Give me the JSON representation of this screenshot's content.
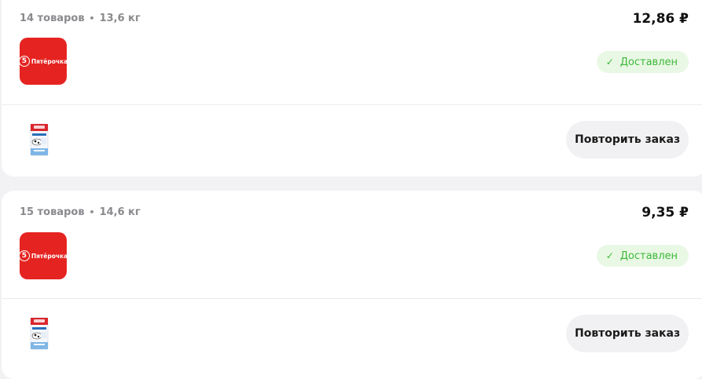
{
  "orders": [
    {
      "items_count": "14 товаров",
      "weight": "13,6 кг",
      "separator": "•",
      "total": "12,86 ₽",
      "store_brand": "Пятёрочка",
      "logo_digit": "5",
      "status_icon": "check-icon",
      "status_check": "✓",
      "status": "Доставлен",
      "repeat_label": "Повторить заказ"
    },
    {
      "items_count": "15 товаров",
      "weight": "14,6 кг",
      "separator": "•",
      "total": "9,35 ₽",
      "store_brand": "Пятёрочка",
      "logo_digit": "5",
      "status_icon": "check-icon",
      "status_check": "✓",
      "status": "Доставлен",
      "repeat_label": "Повторить заказ"
    }
  ],
  "colors": {
    "brand_red": "#e52421",
    "status_bg": "#e9f8e4",
    "status_text": "#3db83a"
  }
}
